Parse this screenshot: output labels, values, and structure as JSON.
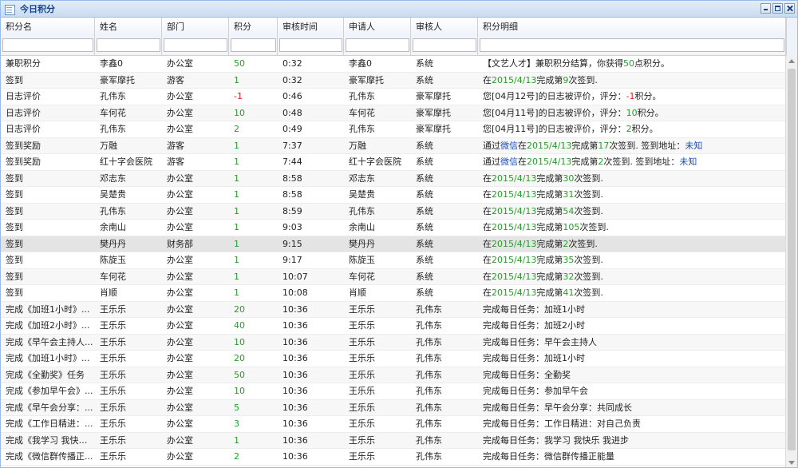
{
  "window": {
    "title": "今日积分"
  },
  "columns": [
    {
      "key": "name",
      "label": "积分名"
    },
    {
      "key": "person",
      "label": "姓名"
    },
    {
      "key": "dept",
      "label": "部门"
    },
    {
      "key": "points",
      "label": "积分"
    },
    {
      "key": "time",
      "label": "审核时间"
    },
    {
      "key": "applicant",
      "label": "申请人"
    },
    {
      "key": "reviewer",
      "label": "审核人"
    },
    {
      "key": "detail",
      "label": "积分明细"
    }
  ],
  "filters": [
    "",
    "",
    "",
    "",
    "",
    "",
    "",
    ""
  ],
  "rows": [
    {
      "name": "兼职积分",
      "person": "李鑫0",
      "dept": "办公室",
      "points": "50",
      "time": "0:32",
      "applicant": "李鑫0",
      "reviewer": "系统",
      "detail": [
        {
          "t": "【文艺人才】兼职积分结算，你获得"
        },
        {
          "t": "50",
          "c": "grn"
        },
        {
          "t": "点积分。"
        }
      ]
    },
    {
      "name": "签到",
      "person": "豪军摩托",
      "dept": "游客",
      "points": "1",
      "time": "0:32",
      "applicant": "豪军摩托",
      "reviewer": "系统",
      "detail": [
        {
          "t": "在"
        },
        {
          "t": "2015/4/13",
          "c": "grn"
        },
        {
          "t": "完成第"
        },
        {
          "t": "9",
          "c": "grn"
        },
        {
          "t": "次签到."
        }
      ]
    },
    {
      "name": "日志评价",
      "person": "孔伟东",
      "dept": "办公室",
      "points": "-1",
      "time": "0:46",
      "applicant": "孔伟东",
      "reviewer": "豪军摩托",
      "detail": [
        {
          "t": "您[04月12号]的日志被评价，评分："
        },
        {
          "t": "-1",
          "c": "red"
        },
        {
          "t": "积分。"
        }
      ]
    },
    {
      "name": "日志评价",
      "person": "车何花",
      "dept": "办公室",
      "points": "10",
      "time": "0:48",
      "applicant": "车何花",
      "reviewer": "豪军摩托",
      "detail": [
        {
          "t": "您[04月11号]的日志被评价，评分："
        },
        {
          "t": "10",
          "c": "grn"
        },
        {
          "t": "积分。"
        }
      ]
    },
    {
      "name": "日志评价",
      "person": "孔伟东",
      "dept": "办公室",
      "points": "2",
      "time": "0:49",
      "applicant": "孔伟东",
      "reviewer": "豪军摩托",
      "detail": [
        {
          "t": "您[04月11号]的日志被评价，评分："
        },
        {
          "t": "2",
          "c": "grn"
        },
        {
          "t": "积分。"
        }
      ]
    },
    {
      "name": "签到奖励",
      "person": "万融",
      "dept": "游客",
      "points": "1",
      "time": "7:37",
      "applicant": "万融",
      "reviewer": "系统",
      "detail": [
        {
          "t": "通过"
        },
        {
          "t": "微信",
          "c": "lnk"
        },
        {
          "t": "在"
        },
        {
          "t": "2015/4/13",
          "c": "grn"
        },
        {
          "t": "完成第"
        },
        {
          "t": "17",
          "c": "grn"
        },
        {
          "t": "次签到. 签到地址："
        },
        {
          "t": "未知",
          "c": "lnk"
        }
      ]
    },
    {
      "name": "签到奖励",
      "person": "红十字会医院",
      "dept": "游客",
      "points": "1",
      "time": "7:44",
      "applicant": "红十字会医院",
      "reviewer": "系统",
      "detail": [
        {
          "t": "通过"
        },
        {
          "t": "微信",
          "c": "lnk"
        },
        {
          "t": "在"
        },
        {
          "t": "2015/4/13",
          "c": "grn"
        },
        {
          "t": "完成第"
        },
        {
          "t": "2",
          "c": "grn"
        },
        {
          "t": "次签到. 签到地址："
        },
        {
          "t": "未知",
          "c": "lnk"
        }
      ]
    },
    {
      "name": "签到",
      "person": "邓志东",
      "dept": "办公室",
      "points": "1",
      "time": "8:58",
      "applicant": "邓志东",
      "reviewer": "系统",
      "detail": [
        {
          "t": "在"
        },
        {
          "t": "2015/4/13",
          "c": "grn"
        },
        {
          "t": "完成第"
        },
        {
          "t": "30",
          "c": "grn"
        },
        {
          "t": "次签到."
        }
      ]
    },
    {
      "name": "签到",
      "person": "吴楚贵",
      "dept": "办公室",
      "points": "1",
      "time": "8:58",
      "applicant": "吴楚贵",
      "reviewer": "系统",
      "detail": [
        {
          "t": "在"
        },
        {
          "t": "2015/4/13",
          "c": "grn"
        },
        {
          "t": "完成第"
        },
        {
          "t": "31",
          "c": "grn"
        },
        {
          "t": "次签到."
        }
      ]
    },
    {
      "name": "签到",
      "person": "孔伟东",
      "dept": "办公室",
      "points": "1",
      "time": "8:59",
      "applicant": "孔伟东",
      "reviewer": "系统",
      "detail": [
        {
          "t": "在"
        },
        {
          "t": "2015/4/13",
          "c": "grn"
        },
        {
          "t": "完成第"
        },
        {
          "t": "54",
          "c": "grn"
        },
        {
          "t": "次签到."
        }
      ]
    },
    {
      "name": "签到",
      "person": "余南山",
      "dept": "办公室",
      "points": "1",
      "time": "9:03",
      "applicant": "余南山",
      "reviewer": "系统",
      "detail": [
        {
          "t": "在"
        },
        {
          "t": "2015/4/13",
          "c": "grn"
        },
        {
          "t": "完成第"
        },
        {
          "t": "105",
          "c": "grn"
        },
        {
          "t": "次签到."
        }
      ]
    },
    {
      "name": "签到",
      "person": "樊丹丹",
      "dept": "财务部",
      "points": "1",
      "time": "9:15",
      "applicant": "樊丹丹",
      "reviewer": "系统",
      "selected": true,
      "detail": [
        {
          "t": "在"
        },
        {
          "t": "2015/4/13",
          "c": "grn"
        },
        {
          "t": "完成第"
        },
        {
          "t": "2",
          "c": "grn"
        },
        {
          "t": "次签到."
        }
      ]
    },
    {
      "name": "签到",
      "person": "陈旋玉",
      "dept": "办公室",
      "points": "1",
      "time": "9:17",
      "applicant": "陈旋玉",
      "reviewer": "系统",
      "detail": [
        {
          "t": "在"
        },
        {
          "t": "2015/4/13",
          "c": "grn"
        },
        {
          "t": "完成第"
        },
        {
          "t": "35",
          "c": "grn"
        },
        {
          "t": "次签到."
        }
      ]
    },
    {
      "name": "签到",
      "person": "车何花",
      "dept": "办公室",
      "points": "1",
      "time": "10:07",
      "applicant": "车何花",
      "reviewer": "系统",
      "detail": [
        {
          "t": "在"
        },
        {
          "t": "2015/4/13",
          "c": "grn"
        },
        {
          "t": "完成第"
        },
        {
          "t": "32",
          "c": "grn"
        },
        {
          "t": "次签到."
        }
      ]
    },
    {
      "name": "签到",
      "person": "肖顺",
      "dept": "办公室",
      "points": "1",
      "time": "10:08",
      "applicant": "肖顺",
      "reviewer": "系统",
      "detail": [
        {
          "t": "在"
        },
        {
          "t": "2015/4/13",
          "c": "grn"
        },
        {
          "t": "完成第"
        },
        {
          "t": "41",
          "c": "grn"
        },
        {
          "t": "次签到."
        }
      ]
    },
    {
      "name": "完成《加班1小时》...",
      "person": "王乐乐",
      "dept": "办公室",
      "points": "20",
      "time": "10:36",
      "applicant": "王乐乐",
      "reviewer": "孔伟东",
      "detail": [
        {
          "t": "完成每日任务：加班1小时"
        }
      ]
    },
    {
      "name": "完成《加班2小时》...",
      "person": "王乐乐",
      "dept": "办公室",
      "points": "40",
      "time": "10:36",
      "applicant": "王乐乐",
      "reviewer": "孔伟东",
      "detail": [
        {
          "t": "完成每日任务：加班2小时"
        }
      ]
    },
    {
      "name": "完成《早午会主持人...",
      "person": "王乐乐",
      "dept": "办公室",
      "points": "10",
      "time": "10:36",
      "applicant": "王乐乐",
      "reviewer": "孔伟东",
      "detail": [
        {
          "t": "完成每日任务：早午会主持人"
        }
      ]
    },
    {
      "name": "完成《加班1小时》...",
      "person": "王乐乐",
      "dept": "办公室",
      "points": "20",
      "time": "10:36",
      "applicant": "王乐乐",
      "reviewer": "孔伟东",
      "detail": [
        {
          "t": "完成每日任务：加班1小时"
        }
      ]
    },
    {
      "name": "完成《全勤奖》任务",
      "person": "王乐乐",
      "dept": "办公室",
      "points": "50",
      "time": "10:36",
      "applicant": "王乐乐",
      "reviewer": "孔伟东",
      "detail": [
        {
          "t": "完成每日任务：全勤奖"
        }
      ]
    },
    {
      "name": "完成《参加早午会》...",
      "person": "王乐乐",
      "dept": "办公室",
      "points": "10",
      "time": "10:36",
      "applicant": "王乐乐",
      "reviewer": "孔伟东",
      "detail": [
        {
          "t": "完成每日任务：参加早午会"
        }
      ]
    },
    {
      "name": "完成《早午会分享：...",
      "person": "王乐乐",
      "dept": "办公室",
      "points": "5",
      "time": "10:36",
      "applicant": "王乐乐",
      "reviewer": "孔伟东",
      "detail": [
        {
          "t": "完成每日任务：早午会分享：共同成长"
        }
      ]
    },
    {
      "name": "完成《工作日精进：...",
      "person": "王乐乐",
      "dept": "办公室",
      "points": "3",
      "time": "10:36",
      "applicant": "王乐乐",
      "reviewer": "孔伟东",
      "detail": [
        {
          "t": "完成每日任务：工作日精进：对自己负责"
        }
      ]
    },
    {
      "name": "完成《我学习 我快乐...",
      "person": "王乐乐",
      "dept": "办公室",
      "points": "1",
      "time": "10:36",
      "applicant": "王乐乐",
      "reviewer": "孔伟东",
      "detail": [
        {
          "t": "完成每日任务：我学习 我快乐 我进步"
        }
      ]
    },
    {
      "name": "完成《微信群传播正...",
      "person": "王乐乐",
      "dept": "办公室",
      "points": "2",
      "time": "10:36",
      "applicant": "王乐乐",
      "reviewer": "孔伟东",
      "detail": [
        {
          "t": "完成每日任务：微信群传播正能量"
        }
      ]
    }
  ]
}
